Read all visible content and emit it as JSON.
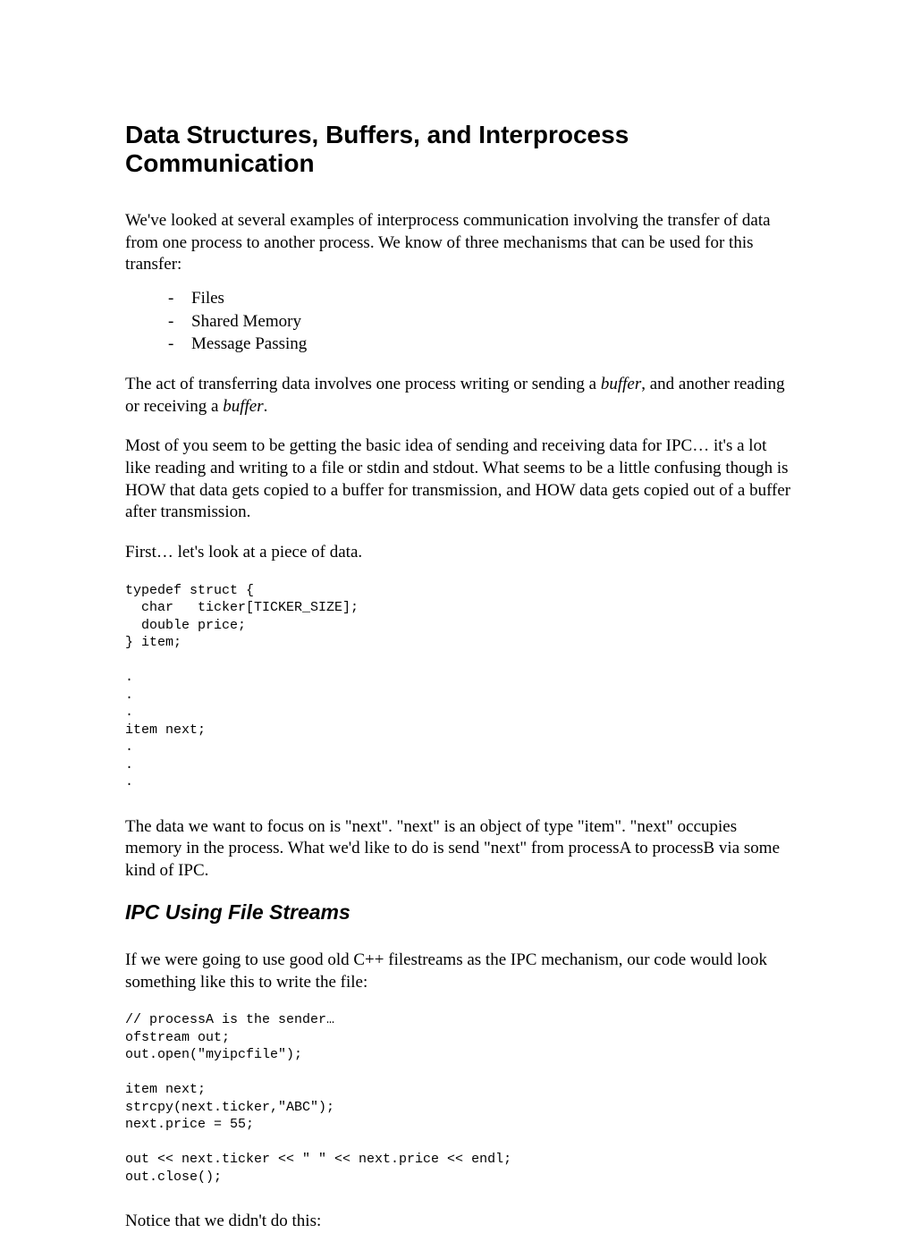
{
  "title": "Data Structures, Buffers, and Interprocess Communication",
  "para1": "We've looked at several examples of interprocess communication involving the transfer of data from one process to another process.  We know of three mechanisms that can be used for this transfer:",
  "list": {
    "item1": "Files",
    "item2": "Shared Memory",
    "item3": "Message Passing"
  },
  "para2_a": "The act of transferring data involves one process writing or sending a ",
  "para2_b": "buffer",
  "para2_c": ", and another reading or receiving a ",
  "para2_d": "buffer",
  "para2_e": ".",
  "para3": "Most of you seem to be getting the basic idea of sending and receiving data for IPC… it's a lot like reading and writing to a file or stdin and stdout.  What seems to be a little confusing though is HOW that data gets copied to a buffer for transmission, and HOW data gets copied out of a buffer after transmission.",
  "para4": "First… let's look at a piece of data.",
  "code1": "typedef struct {\n  char   ticker[TICKER_SIZE];\n  double price;\n} item;\n\n.\n.\n.\nitem next;\n.\n.\n.",
  "para5": "The data we want to focus on is \"next\".  \"next\" is an object of type \"item\".  \"next\" occupies memory in the process.  What we'd like to do is send \"next\" from processA to processB via some kind of IPC.",
  "subtitle": "IPC Using File Streams",
  "para6": "If we were going to use good old C++ filestreams as the IPC mechanism, our code would look something like this to write the file:",
  "code2": "// processA is the sender…\nofstream out;\nout.open(\"myipcfile\");\n\nitem next;\nstrcpy(next.ticker,\"ABC\");\nnext.price = 55;\n\nout << next.ticker << \" \" << next.price << endl;\nout.close();",
  "para7": "Notice that we didn't do this:"
}
